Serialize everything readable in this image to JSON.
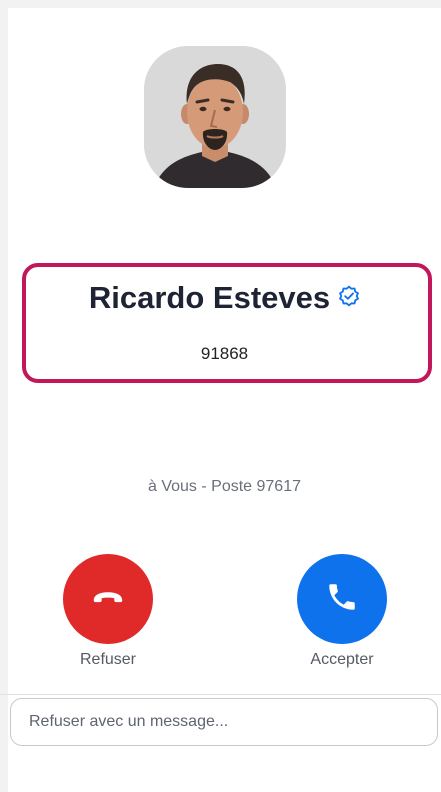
{
  "caller": {
    "name": "Ricardo Esteves",
    "number": "91868",
    "verified_icon": "verified-badge-icon"
  },
  "call_info": {
    "to_line": "à Vous - Poste 97617"
  },
  "actions": {
    "decline_label": "Refuser",
    "accept_label": "Accepter",
    "decline_icon": "phone-hangup-icon",
    "accept_icon": "phone-icon"
  },
  "message": {
    "placeholder": "Refuser avec un message..."
  },
  "colors": {
    "decline": "#e02a2a",
    "accept": "#0e72ed",
    "highlight": "#c2185b",
    "verified": "#0e72ed"
  }
}
